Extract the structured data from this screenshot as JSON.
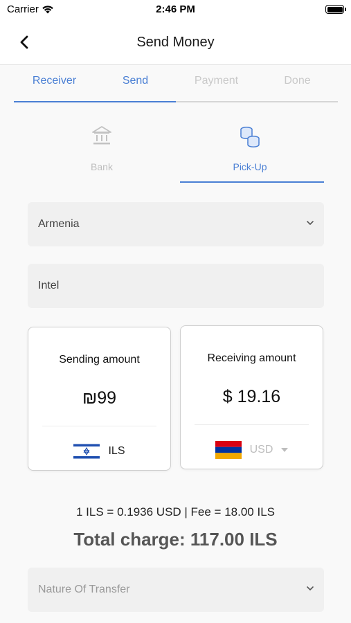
{
  "status": {
    "carrier": "Carrier",
    "time": "2:46 PM"
  },
  "nav": {
    "title": "Send Money"
  },
  "steps": [
    {
      "label": "Receiver",
      "state": "active"
    },
    {
      "label": "Send",
      "state": "active"
    },
    {
      "label": "Payment",
      "state": "inactive"
    },
    {
      "label": "Done",
      "state": "inactive"
    }
  ],
  "method_tabs": {
    "bank": "Bank",
    "pickup": "Pick-Up",
    "selected": "Pick-Up"
  },
  "country_select": {
    "value": "Armenia"
  },
  "agent_field": {
    "value": "Intel"
  },
  "sending": {
    "title": "Sending amount",
    "amount": "₪99",
    "currency": "ILS"
  },
  "receiving": {
    "title": "Receiving amount",
    "amount": "$ 19.16",
    "currency": "USD"
  },
  "rate": "1 ILS = 0.1936 USD | Fee = 18.00 ILS",
  "total": "Total charge: 117.00 ILS",
  "nature_select": {
    "placeholder": "Nature Of Transfer"
  },
  "colors": {
    "accent": "#4a7fd4",
    "inactive": "#c9c9c9",
    "field_bg": "#f0f0f0"
  },
  "icons": [
    "wifi-icon",
    "battery-icon",
    "back-arrow-icon",
    "bank-icon",
    "coins-icon",
    "chevron-down-icon",
    "israel-flag-icon",
    "armenia-flag-icon",
    "caret-down-icon"
  ]
}
